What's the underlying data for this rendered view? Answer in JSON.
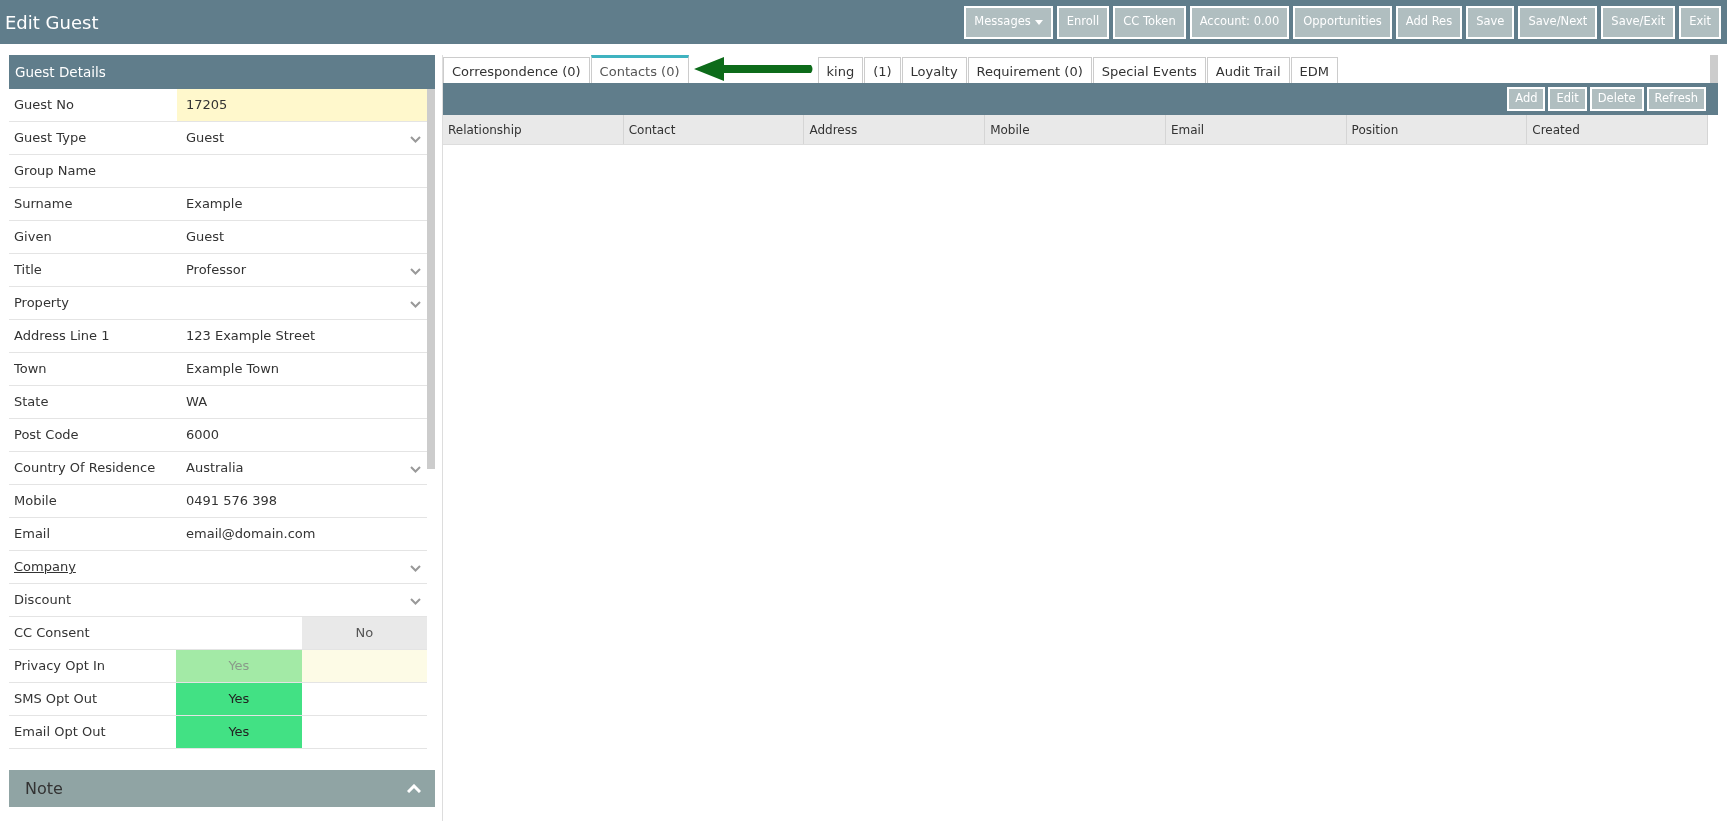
{
  "window": {
    "title": "Edit Guest"
  },
  "toolbar": [
    {
      "label": "Messages",
      "kind": "dropdown"
    },
    {
      "label": "Enroll",
      "kind": "button"
    },
    {
      "label": "CC Token",
      "kind": "button"
    },
    {
      "label": "Account: 0.00",
      "kind": "button"
    },
    {
      "label": "Opportunities",
      "kind": "button"
    },
    {
      "label": "Add Res",
      "kind": "button"
    },
    {
      "label": "Save",
      "kind": "button"
    },
    {
      "label": "Save/Next",
      "kind": "button"
    },
    {
      "label": "Save/Exit",
      "kind": "button"
    },
    {
      "label": "Exit",
      "kind": "button"
    }
  ],
  "guest_details": {
    "title": "Guest Details",
    "fields": [
      {
        "label": "Guest No",
        "value": "17205",
        "kind": "readonly"
      },
      {
        "label": "Guest Type",
        "value": "Guest",
        "kind": "select"
      },
      {
        "label": "Group Name",
        "kind": "text"
      },
      {
        "label": "Surname",
        "value": "Example",
        "kind": "text"
      },
      {
        "label": "Given",
        "value": "Guest",
        "kind": "text"
      },
      {
        "label": "Title",
        "value": "Professor",
        "kind": "select"
      },
      {
        "label": "Property",
        "kind": "select"
      },
      {
        "label": "Address Line 1",
        "value": "123 Example Street",
        "kind": "text"
      },
      {
        "label": "Town",
        "value": "Example Town",
        "kind": "text"
      },
      {
        "label": "State",
        "value": "WA",
        "kind": "text"
      },
      {
        "label": "Post Code",
        "value": "6000",
        "kind": "text"
      },
      {
        "label": "Country Of Residence",
        "value": "Australia",
        "kind": "select"
      },
      {
        "label": "Mobile",
        "value": "0491 576 398",
        "kind": "text"
      },
      {
        "label": "Email",
        "value": "email@domain.com",
        "kind": "text"
      },
      {
        "label": "Company",
        "kind": "lookup"
      },
      {
        "label": "Discount",
        "kind": "select"
      },
      {
        "label": "CC Consent",
        "value": "No",
        "kind": "toggle",
        "on": false,
        "disabled": false
      },
      {
        "label": "Privacy Opt In",
        "value": "Yes",
        "kind": "toggle",
        "on": true,
        "disabled": true
      },
      {
        "label": "SMS Opt Out",
        "value": "Yes",
        "kind": "toggle",
        "on": true,
        "disabled": false
      },
      {
        "label": "Email Opt Out",
        "value": "Yes",
        "kind": "toggle",
        "on": true,
        "disabled": false
      }
    ]
  },
  "note": {
    "title": "Note",
    "expanded": false
  },
  "tabs": [
    {
      "label": "Correspondence (0)",
      "selected": false
    },
    {
      "label": "Contacts (0)",
      "selected": true
    },
    {
      "label": "king",
      "selected": false
    },
    {
      "label": "(1)",
      "selected": false
    },
    {
      "label": "Loyalty",
      "selected": false
    },
    {
      "label": "Requirement (0)",
      "selected": false
    },
    {
      "label": "Special Events",
      "selected": false
    },
    {
      "label": "Audit Trail",
      "selected": false
    },
    {
      "label": "EDM",
      "selected": false
    }
  ],
  "contacts_toolbar": [
    "Add",
    "Edit",
    "Delete",
    "Refresh"
  ],
  "table": {
    "columns": [
      "Relationship",
      "Contact",
      "Address",
      "Mobile",
      "Email",
      "Position",
      "Created"
    ]
  }
}
